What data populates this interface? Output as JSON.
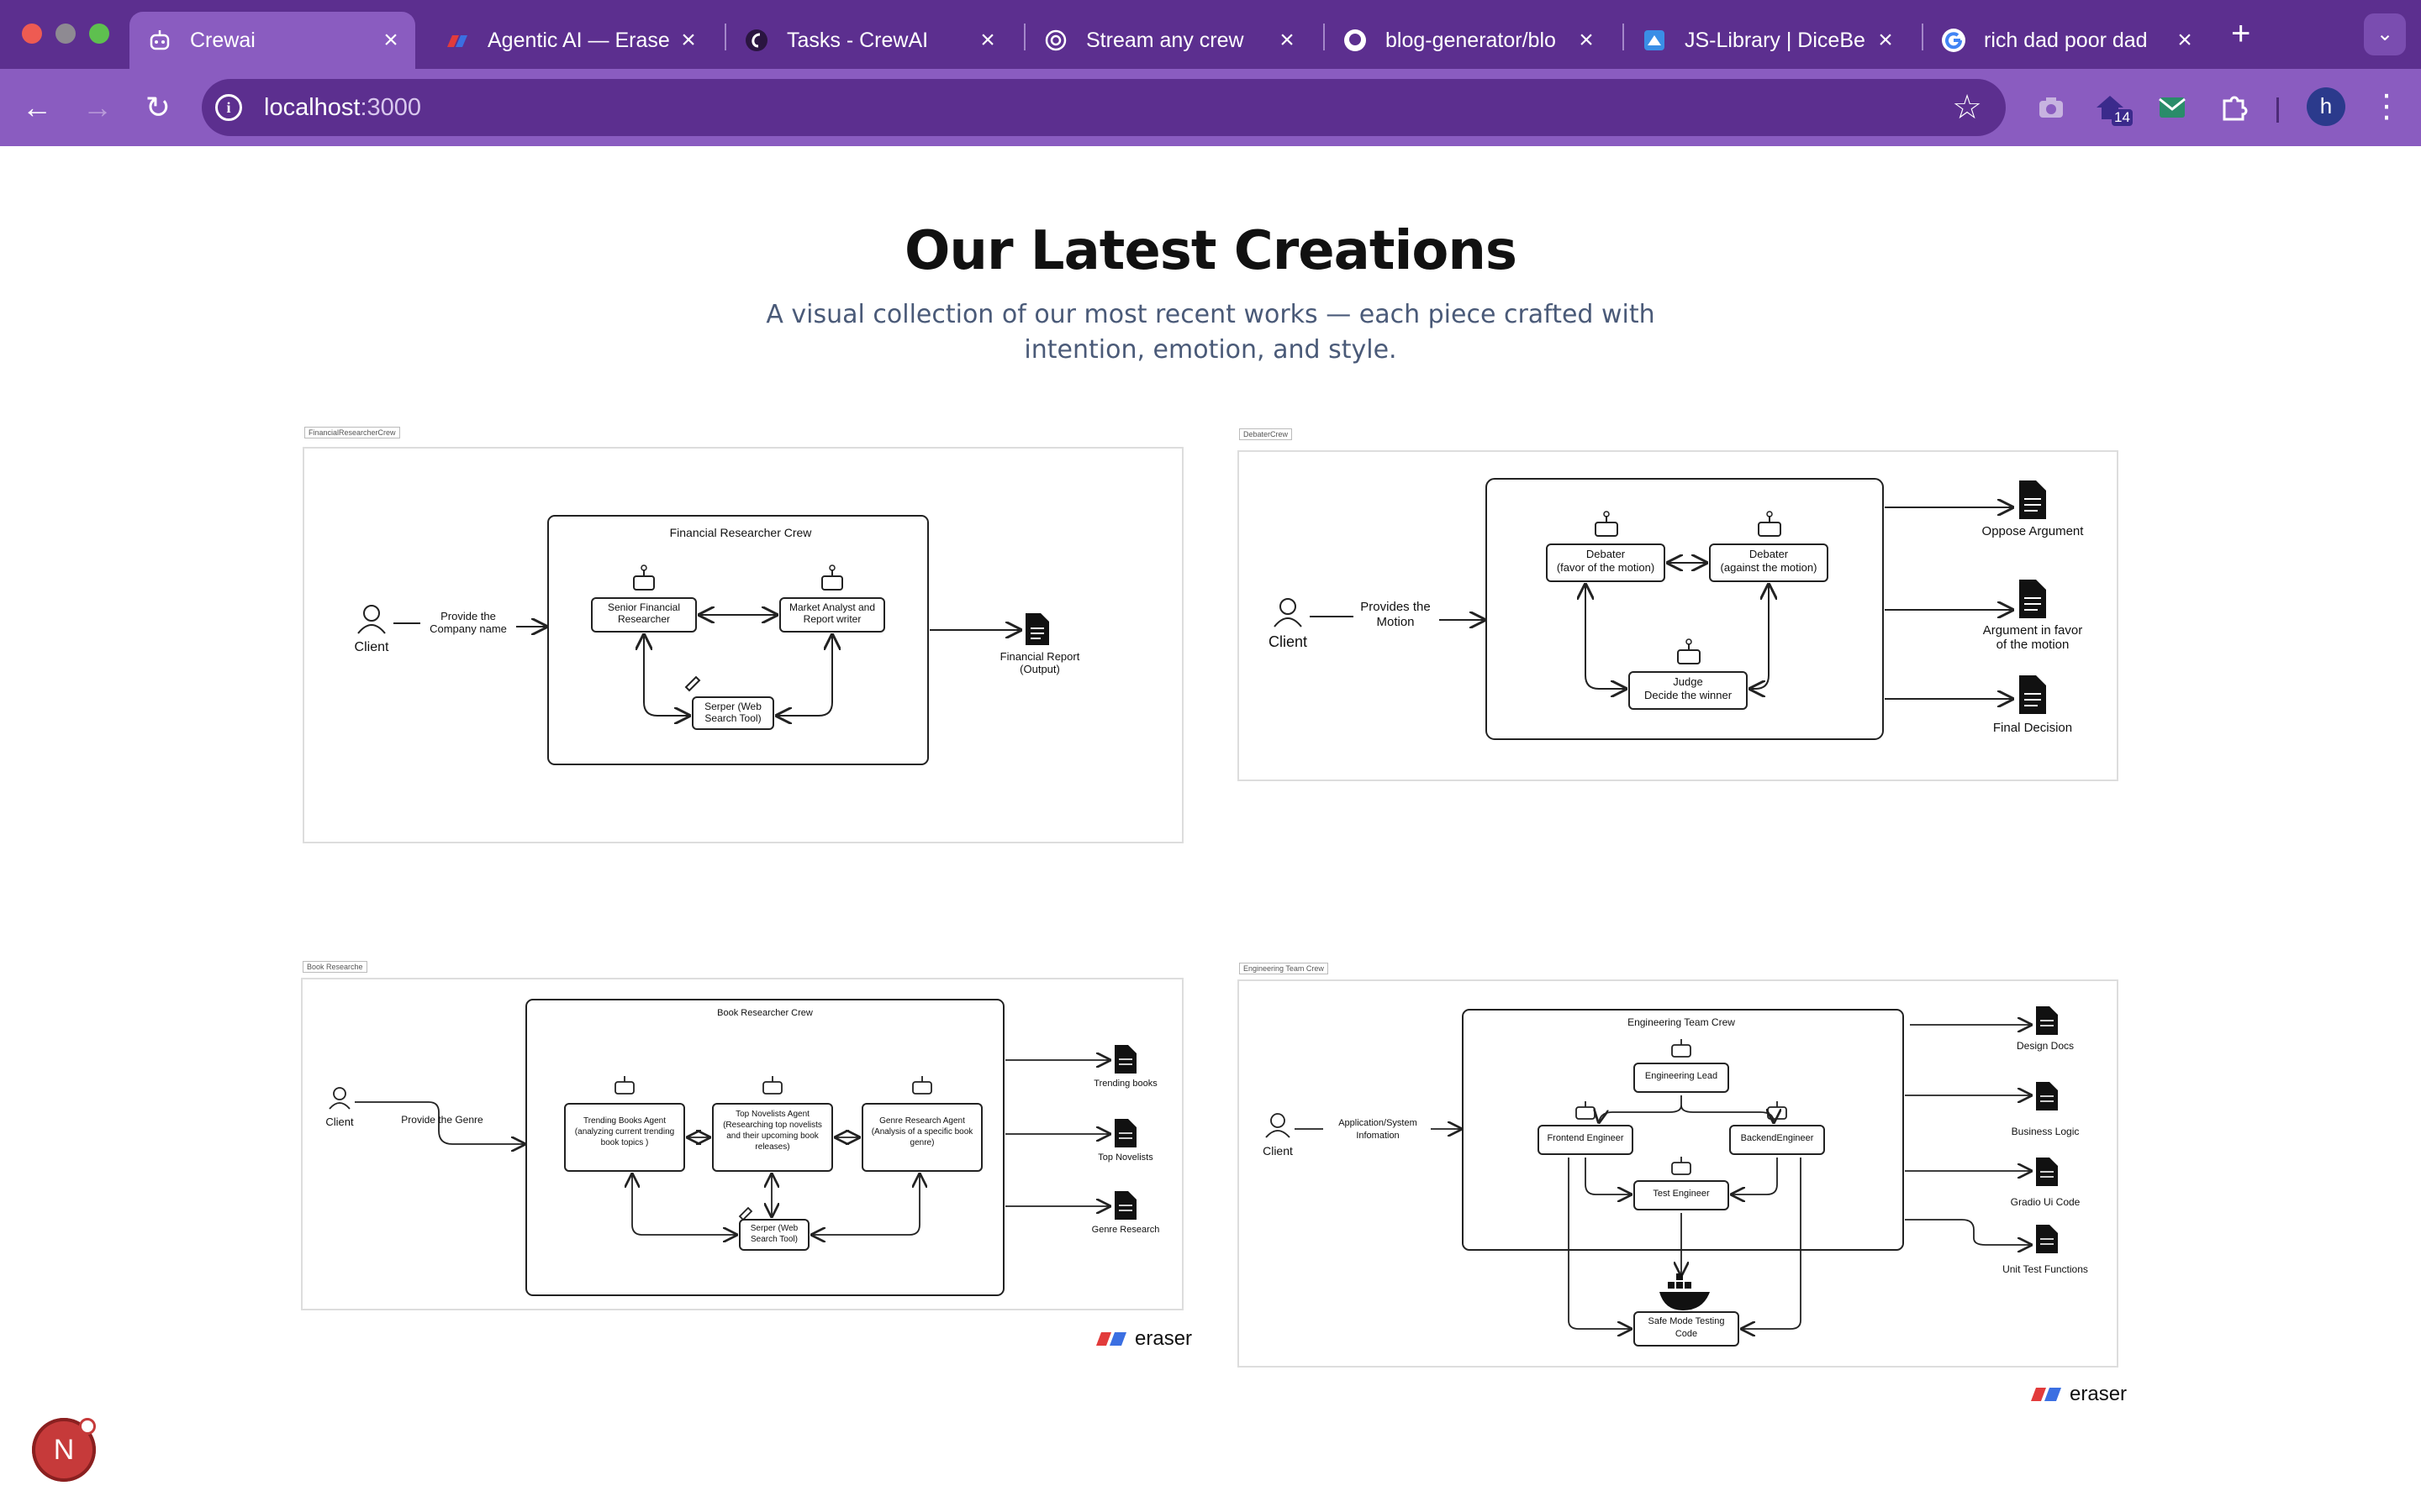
{
  "browser": {
    "tabs": [
      {
        "title": "Crewai",
        "icon": "robot-icon",
        "active": true
      },
      {
        "title": "Agentic AI — Erase",
        "icon": "eraser-icon"
      },
      {
        "title": "Tasks - CrewAI",
        "icon": "crewai-icon"
      },
      {
        "title": "Stream any crew",
        "icon": "openai-icon"
      },
      {
        "title": "blog-generator/blo",
        "icon": "github-icon"
      },
      {
        "title": "JS-Library | DiceBe",
        "icon": "dicebear-icon"
      },
      {
        "title": "rich dad poor dad",
        "icon": "google-icon"
      }
    ],
    "url_host": "localhost",
    "url_port": ":3000",
    "extension_badge": "14",
    "profile_initial": "h",
    "colors": {
      "tabbar": "#5c2f8f",
      "toolbar": "#8a5cc0"
    }
  },
  "page": {
    "title": "Our Latest Creations",
    "subtitle": "A visual collection of our most recent works — each piece crafted with intention, emotion, and style."
  },
  "cards": {
    "financial": {
      "tag": "FinancialResearcherCrew",
      "title": "Financial Researcher Crew",
      "client": "Client",
      "input": "Provide the\nCompany name",
      "agent1": "Senior Financial\nResearcher",
      "agent2": "Market Analyst and\nReport writer",
      "tool": "Serper (Web\nSearch Tool)",
      "output": "Financial Report\n(Output)"
    },
    "debater": {
      "tag": "DebaterCrew",
      "client": "Client",
      "input": "Provides the\nMotion",
      "agent1": "Debater\n(favor of the motion)",
      "agent2": "Debater\n(against the motion)",
      "judge": "Judge\nDecide the winner",
      "out1": "Oppose Argument",
      "out2": "Argument in favor\nof the motion",
      "out3": "Final Decision"
    },
    "book": {
      "tag": "Book Researche",
      "title": "Book Researcher Crew",
      "client": "Client",
      "input": "Provide the Genre",
      "agent1": "Trending Books Agent\n(analyzing current trending\nbook topics )",
      "agent2": "Top Novelists Agent\n(Researching top novelists\nand their upcoming book\nreleases)",
      "agent3": "Genre Research Agent\n(Analysis of a specific book\ngenre)",
      "tool": "Serper (Web\nSearch Tool)",
      "out1": "Trending books",
      "out2": "Top Novelists",
      "out3": "Genre Research"
    },
    "engineering": {
      "tag": "Engineering Team Crew",
      "title": "Engineering Team Crew",
      "client": "Client",
      "input": "Application/System\nInfomation",
      "lead": "Engineering Lead",
      "frontend": "Frontend Engineer",
      "backend": "BackendEngineer",
      "test": "Test Engineer",
      "safe": "Safe Mode Testing\nCode",
      "out1": "Design Docs",
      "out2": "Business Logic",
      "out3": "Gradio Ui Code",
      "out4": "Unit Test Functions"
    },
    "brand": "eraser"
  },
  "dev_badge": "N"
}
